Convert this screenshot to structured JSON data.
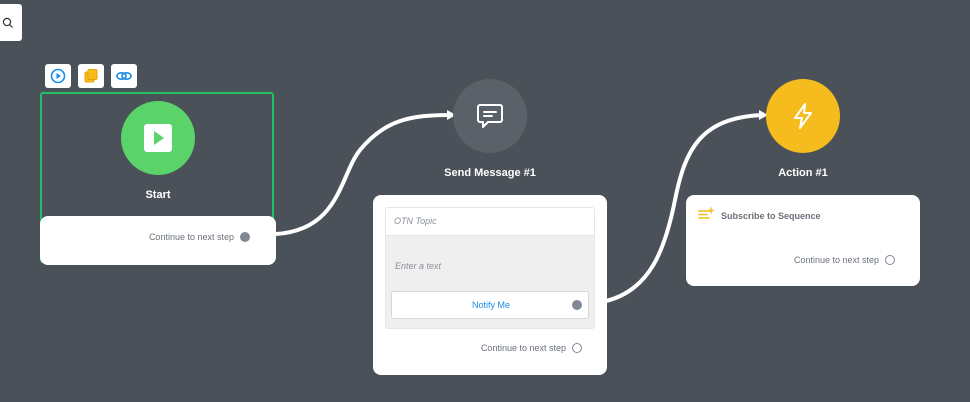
{
  "toolbar": {
    "search_icon": "search-icon",
    "buttons": [
      "play-icon",
      "copy-icon",
      "link-icon"
    ]
  },
  "start_node": {
    "title": "Start",
    "continue_label": "Continue to next step",
    "color": "#5bd36b"
  },
  "send_message_node": {
    "title": "Send Message #1",
    "otn_topic_placeholder": "OTN Topic",
    "text_placeholder": "Enter a text",
    "notify_button_label": "Notify Me",
    "continue_label": "Continue to next step",
    "color": "#5a6168"
  },
  "action_node": {
    "title": "Action #1",
    "action_label": "Subscribe to Sequence",
    "continue_label": "Continue to next step",
    "color": "#f6bb1c"
  },
  "colors": {
    "canvas": "#4a5158",
    "selected_border": "#21c064",
    "link_blue": "#1a8ce8"
  }
}
